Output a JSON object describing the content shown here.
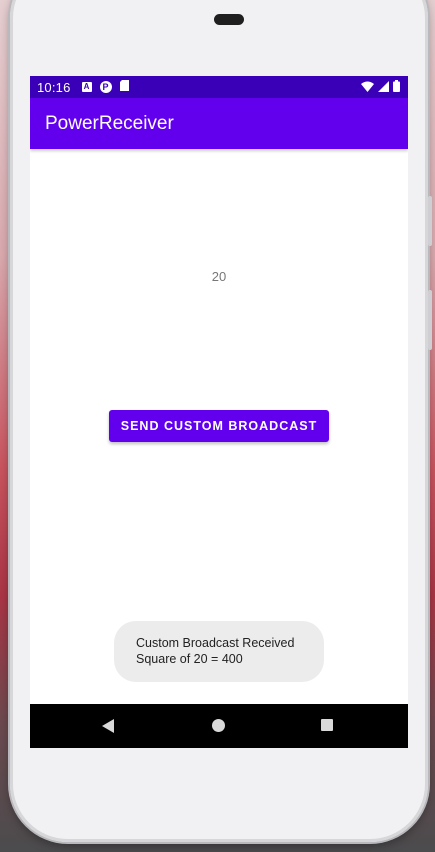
{
  "status_bar": {
    "time": "10:16",
    "icons": [
      "A",
      "P",
      "sd-card-icon"
    ],
    "right_icons": [
      "wifi-icon",
      "signal-icon",
      "battery-icon"
    ],
    "color": "#3a00b8"
  },
  "app_bar": {
    "title": "PowerReceiver",
    "color": "#6200ee"
  },
  "main": {
    "number_text": "20",
    "send_button_label": "SEND CUSTOM BROADCAST"
  },
  "toast": {
    "line1": "Custom Broadcast Received",
    "line2": "Square of 20 = 400"
  },
  "nav_bar": {
    "buttons": [
      "back-icon",
      "home-icon",
      "recents-icon"
    ]
  }
}
